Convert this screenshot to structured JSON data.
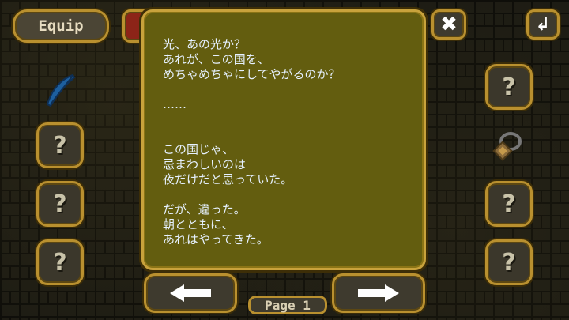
{
  "header": {
    "equip_label": "Equip",
    "close_icon": "close-icon",
    "back_icon": "return-icon"
  },
  "left_slots": [
    {
      "item": "blue-feather-icon",
      "locked": false
    },
    {
      "label": "?",
      "locked": true
    },
    {
      "label": "?",
      "locked": true
    },
    {
      "label": "?",
      "locked": true
    }
  ],
  "right_slots": [
    {
      "label": "?",
      "locked": true
    },
    {
      "item": "ring-icon",
      "locked": false
    },
    {
      "label": "?",
      "locked": true
    },
    {
      "label": "?",
      "locked": true
    }
  ],
  "dialog": {
    "lines": [
      "光、あの光か？",
      "あれが、この国を、",
      "めちゃめちゃにしてやがるのか？",
      "",
      "……",
      "",
      "",
      "この国じゃ、",
      "忌まわしいのは",
      "夜だけだと思っていた。",
      "",
      "だが、違った。",
      "朝とともに、",
      "あれはやってきた。"
    ]
  },
  "pager": {
    "page_label": "Page 1",
    "prev_icon": "arrow-left-icon",
    "next_icon": "arrow-right-icon"
  },
  "colors": {
    "dialog_bg": "#635d0f",
    "frame_gold": "#c8a23c",
    "text": "#e6f1ff"
  }
}
